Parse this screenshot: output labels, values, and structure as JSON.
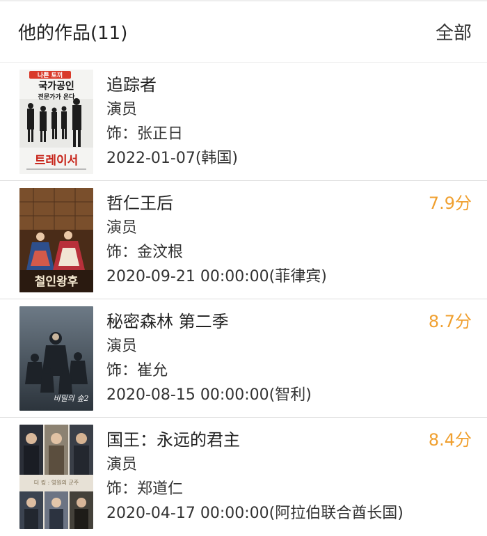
{
  "header": {
    "title": "他的作品(11)",
    "all_label": "全部"
  },
  "works": [
    {
      "title": "追踪者",
      "role": "演员",
      "character": "饰：张正日",
      "date": "2022-01-07(韩国)",
      "score": "",
      "poster_text": [
        "나쁜 토끼",
        "국가공인",
        "전문가가 온다",
        "트레이서"
      ]
    },
    {
      "title": "哲仁王后",
      "role": "演员",
      "character": "饰：金汶根",
      "date": "2020-09-21 00:00:00(菲律宾)",
      "score": "7.9分",
      "poster_text": [
        "철인왕후"
      ]
    },
    {
      "title": "秘密森林 第二季",
      "role": "演员",
      "character": "饰：崔允",
      "date": "2020-08-15 00:00:00(智利)",
      "score": "8.7分",
      "poster_text": [
        "비밀의 숲2"
      ]
    },
    {
      "title": "国王：永远的君主",
      "role": "演员",
      "character": "饰：郑道仁",
      "date": "2020-04-17 00:00:00(阿拉伯联合酋长国)",
      "score": "8.4分",
      "poster_text": [
        "더 킹 : 영원의 군주"
      ]
    }
  ]
}
